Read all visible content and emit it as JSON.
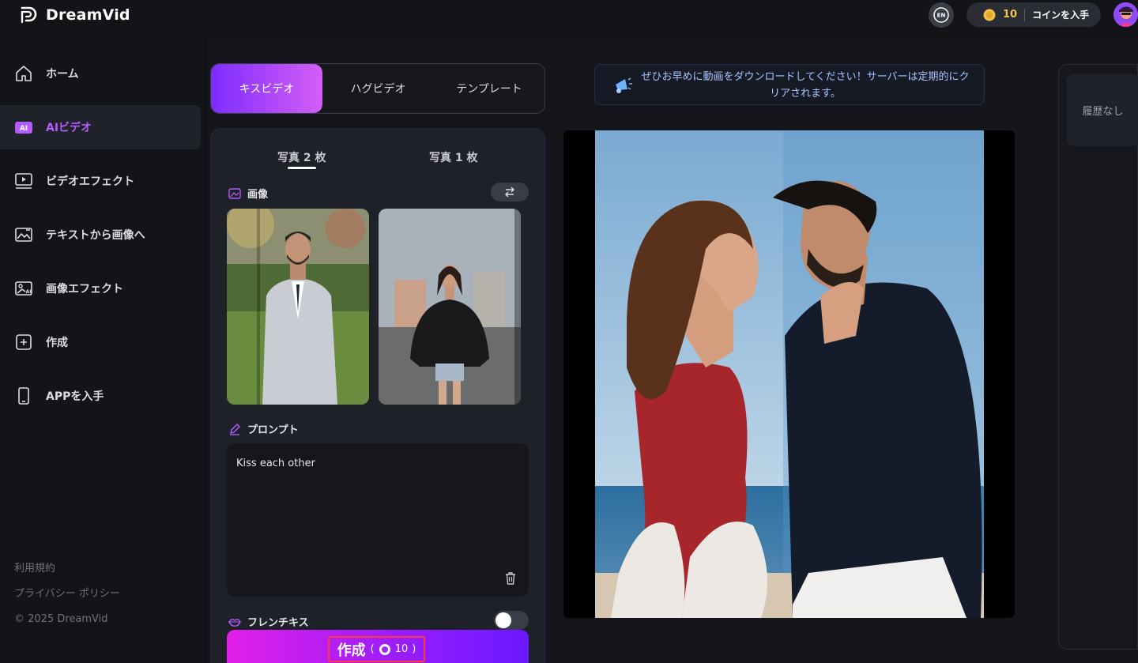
{
  "header": {
    "brand": "DreamVid",
    "lang": "EN",
    "coins": "10",
    "get_coins": "コインを入手"
  },
  "sidebar": {
    "items": [
      {
        "label": "ホーム",
        "icon": "home-icon"
      },
      {
        "label": "AIビデオ",
        "icon": "ai-badge-icon",
        "active": true
      },
      {
        "label": "ビデオエフェクト",
        "icon": "video-effect-icon"
      },
      {
        "label": "テキストから画像へ",
        "icon": "text-to-image-icon"
      },
      {
        "label": "画像エフェクト",
        "icon": "image-effect-icon"
      },
      {
        "label": "作成",
        "icon": "create-icon"
      },
      {
        "label": "APPを入手",
        "icon": "phone-icon"
      }
    ],
    "footer": [
      "利用規約",
      "プライバシー ポリシー",
      "© 2025 DreamVid"
    ]
  },
  "mode_tabs": [
    "キスビデオ",
    "ハグビデオ",
    "テンプレート"
  ],
  "panel": {
    "photo_tabs": [
      "写真 2 枚",
      "写真 1 枚"
    ],
    "image_label": "画像",
    "prompt_label": "プロンプト",
    "prompt_value": "Kiss each other",
    "french_kiss_label": "フレンチキス",
    "french_kiss_enabled": false,
    "create_label": "作成",
    "create_cost_open": "(",
    "create_cost": "10",
    "create_cost_close": ")"
  },
  "notice": {
    "text": "ぜひお早めに動画をダウンロードしてください！サーバーは定期的にクリアされます。"
  },
  "history": {
    "empty": "履歴なし"
  },
  "colors": {
    "accent": "#b45cff",
    "create_gradient_start": "#e120e8",
    "create_gradient_end": "#6a18ff",
    "notice_text": "#a9c4ff",
    "coin": "#f4c34a"
  }
}
